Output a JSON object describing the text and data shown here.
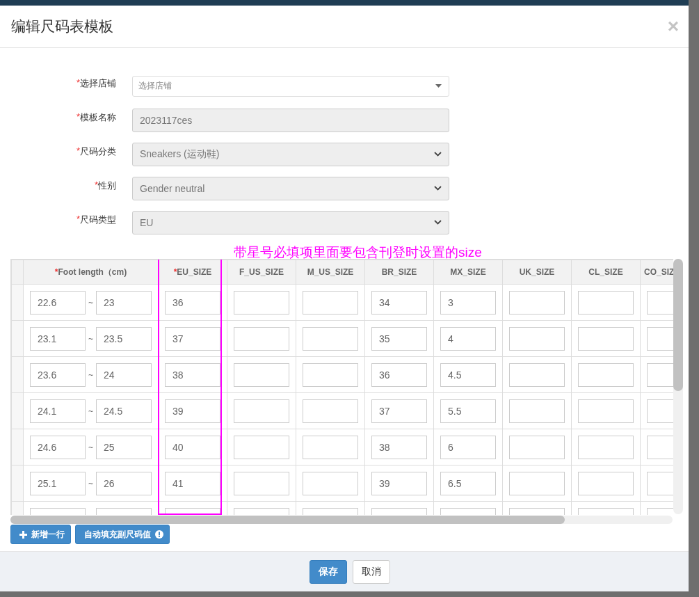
{
  "dialog": {
    "title": "编辑尺码表模板",
    "close": "×"
  },
  "form": [
    {
      "required_mark": "*",
      "label": "选择店铺",
      "kind": "dropdown",
      "placeholder": "选择店铺",
      "disabled": false
    },
    {
      "required_mark": "*",
      "label": "模板名称",
      "kind": "text",
      "value": "2023117ces",
      "disabled": true
    },
    {
      "required_mark": "*",
      "label": "尺码分类",
      "kind": "select",
      "value": "Sneakers (运动鞋)",
      "disabled": true
    },
    {
      "required_mark": "*",
      "label": "性别",
      "kind": "select",
      "value": "Gender neutral",
      "disabled": true
    },
    {
      "required_mark": "*",
      "label": "尺码类型",
      "kind": "select",
      "value": "EU",
      "disabled": true
    }
  ],
  "annotation": {
    "text": "带星号必填项里面要包含刊登时设置的size"
  },
  "table": {
    "columns": [
      {
        "required_mark": "*",
        "label": "Foot length（cm)"
      },
      {
        "required_mark": "*",
        "label": "EU_SIZE"
      },
      {
        "label": "F_US_SIZE"
      },
      {
        "label": "M_US_SIZE"
      },
      {
        "label": "BR_SIZE"
      },
      {
        "label": "MX_SIZE"
      },
      {
        "label": "UK_SIZE"
      },
      {
        "label": "CL_SIZE"
      },
      {
        "label": "CO_SIZ"
      }
    ],
    "rows": [
      {
        "foot_length": [
          "22.6",
          "23"
        ],
        "separator": "~",
        "eu_size": "36",
        "br_size": "34",
        "mx_size": "3"
      },
      {
        "foot_length": [
          "23.1",
          "23.5"
        ],
        "separator": "~",
        "eu_size": "37",
        "br_size": "35",
        "mx_size": "4"
      },
      {
        "foot_length": [
          "23.6",
          "24"
        ],
        "separator": "~",
        "eu_size": "38",
        "br_size": "36",
        "mx_size": "4.5"
      },
      {
        "foot_length": [
          "24.1",
          "24.5"
        ],
        "separator": "~",
        "eu_size": "39",
        "br_size": "37",
        "mx_size": "5.5"
      },
      {
        "foot_length": [
          "24.6",
          "25"
        ],
        "separator": "~",
        "eu_size": "40",
        "br_size": "38",
        "mx_size": "6"
      },
      {
        "foot_length": [
          "25.1",
          "26"
        ],
        "separator": "~",
        "eu_size": "41",
        "br_size": "39",
        "mx_size": "6.5"
      }
    ]
  },
  "actions": [
    {
      "label": "新增一行",
      "kind": "add"
    },
    {
      "label": "自动填充副尺码值",
      "kind": "info"
    }
  ],
  "footer": [
    {
      "label": "保存",
      "kind": "primary"
    },
    {
      "label": "取消",
      "kind": "default"
    }
  ]
}
